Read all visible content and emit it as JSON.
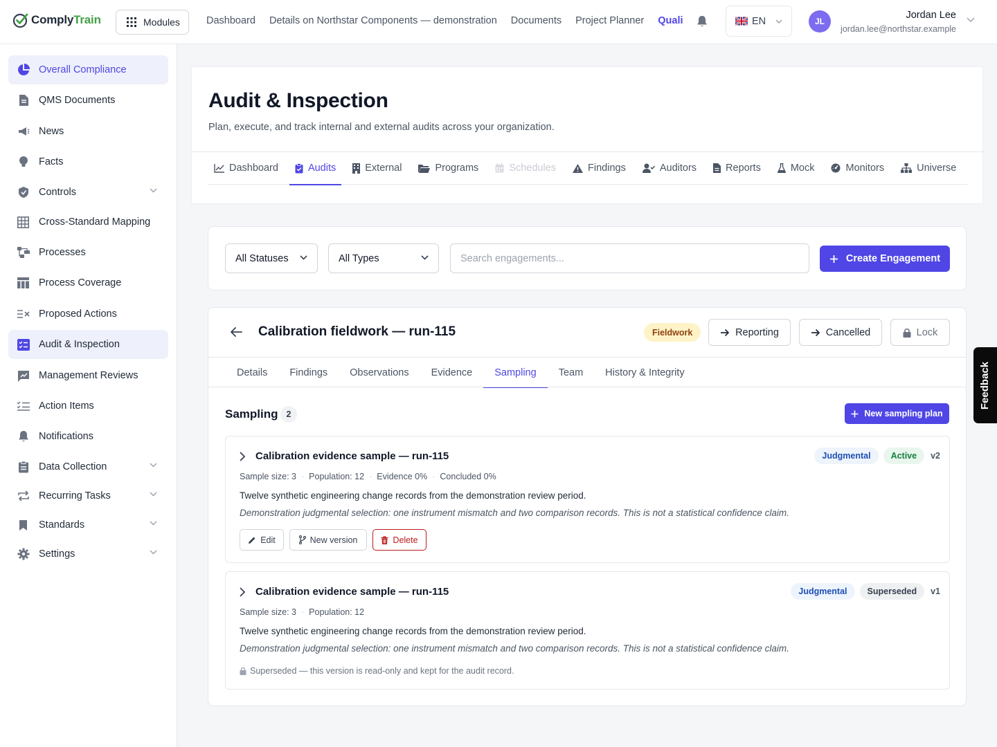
{
  "app": {
    "logo": {
      "part1": "Comply",
      "part2": "Train"
    },
    "modules_label": "Modules",
    "nav": [
      "Dashboard",
      "Details on Northstar Components — demonstration",
      "Documents",
      "Project Planner",
      "Quali"
    ],
    "language": "EN",
    "user": {
      "initials": "JL",
      "name": "Jordan Lee",
      "email": "jordan.lee@northstar.example"
    }
  },
  "sidebar": {
    "items": [
      {
        "label": "Overall Compliance",
        "icon": "pie-chart-icon"
      },
      {
        "label": "QMS Documents",
        "icon": "document-icon"
      },
      {
        "label": "News",
        "icon": "megaphone-icon"
      },
      {
        "label": "Facts",
        "icon": "lightbulb-icon"
      },
      {
        "label": "Controls",
        "icon": "shield-icon"
      },
      {
        "label": "Cross-Standard Mapping",
        "icon": "grid-icon"
      },
      {
        "label": "Processes",
        "icon": "flow-icon"
      },
      {
        "label": "Process Coverage",
        "icon": "table-icon"
      },
      {
        "label": "Proposed Actions",
        "icon": "list-x-icon"
      },
      {
        "label": "Audit & Inspection",
        "icon": "checklist-icon"
      },
      {
        "label": "Management Reviews",
        "icon": "chat-chart-icon"
      },
      {
        "label": "Action Items",
        "icon": "checklist-lines-icon"
      },
      {
        "label": "Notifications",
        "icon": "bell-icon"
      },
      {
        "label": "Data Collection",
        "icon": "clipboard-icon"
      },
      {
        "label": "Recurring Tasks",
        "icon": "repeat-icon"
      },
      {
        "label": "Standards",
        "icon": "bookmark-icon"
      },
      {
        "label": "Settings",
        "icon": "gear-icon"
      }
    ]
  },
  "page": {
    "title": "Audit & Inspection",
    "subtitle": "Plan, execute, and track internal and external audits across your organization.",
    "tabs": [
      {
        "label": "Dashboard",
        "icon": "chart-line-icon"
      },
      {
        "label": "Audits",
        "icon": "clipboard-check-icon"
      },
      {
        "label": "External",
        "icon": "building-icon"
      },
      {
        "label": "Programs",
        "icon": "folder-icon"
      },
      {
        "label": "Schedules",
        "icon": "calendar-icon"
      },
      {
        "label": "Findings",
        "icon": "warning-icon"
      },
      {
        "label": "Auditors",
        "icon": "user-check-icon"
      },
      {
        "label": "Reports",
        "icon": "report-icon"
      },
      {
        "label": "Mock",
        "icon": "flask-icon"
      },
      {
        "label": "Monitors",
        "icon": "gauge-icon"
      },
      {
        "label": "Universe",
        "icon": "hierarchy-icon"
      }
    ]
  },
  "filters": {
    "status": "All Statuses",
    "type": "All Types",
    "search_placeholder": "Search engagements...",
    "create_label": "Create Engagement"
  },
  "engagement": {
    "title": "Calibration fieldwork — run-115",
    "phase": "Fieldwork",
    "actions": {
      "reporting": "Reporting",
      "cancelled": "Cancelled",
      "lock": "Lock"
    },
    "subtabs": [
      "Details",
      "Findings",
      "Observations",
      "Evidence",
      "Sampling",
      "Team",
      "History & Integrity"
    ],
    "sampling": {
      "title": "Sampling",
      "count": "2",
      "new_plan_label": "New sampling plan",
      "plans": [
        {
          "title": "Calibration evidence sample — run-115",
          "method": "Judgmental",
          "status": "Active",
          "version": "v2",
          "sample_size": "Sample size: 3",
          "population": "Population: 12",
          "evidence": "Evidence 0%",
          "concluded": "Concluded 0%",
          "description": "Twelve synthetic engineering change records from the demonstration review period.",
          "note": "Demonstration judgmental selection: one instrument mismatch and two comparison records. This is not a statistical confidence claim.",
          "buttons": {
            "edit": "Edit",
            "new_version": "New version",
            "delete": "Delete"
          }
        },
        {
          "title": "Calibration evidence sample — run-115",
          "method": "Judgmental",
          "status": "Superseded",
          "version": "v1",
          "sample_size": "Sample size: 3",
          "population": "Population: 12",
          "description": "Twelve synthetic engineering change records from the demonstration review period.",
          "note": "Demonstration judgmental selection: one instrument mismatch and two comparison records. This is not a statistical confidence claim.",
          "readonly_note": "Superseded — this version is read-only and kept for the audit record."
        }
      ]
    }
  },
  "feedback_label": "Feedback"
}
